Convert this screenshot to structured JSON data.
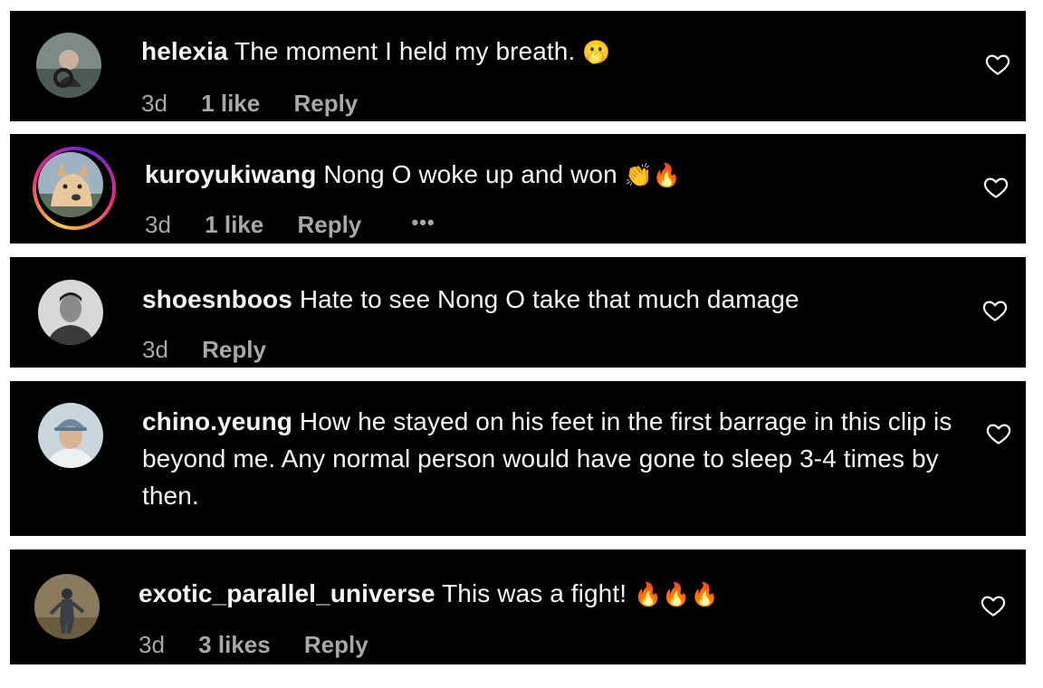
{
  "comments": [
    {
      "username": "helexia",
      "text": "The moment I held my breath.",
      "emoji": "🫢",
      "time": "3d",
      "likes": "1 like",
      "reply": "Reply"
    },
    {
      "username": "kuroyukiwang",
      "text": "Nong O woke up and won",
      "emoji": "👏🔥",
      "time": "3d",
      "likes": "1 like",
      "reply": "Reply",
      "more": "•••"
    },
    {
      "username": "shoesnboos",
      "text": "Hate to see Nong O take that much damage",
      "emoji": "",
      "time": "3d",
      "likes": "",
      "reply": "Reply"
    },
    {
      "username": "chino.yeung",
      "text": "How he stayed on his feet in the first barrage in this clip is beyond me. Any normal person would have gone to sleep 3-4 times by then.",
      "emoji": "",
      "time": "",
      "likes": "",
      "reply": ""
    },
    {
      "username": "exotic_parallel_universe",
      "text": "This was a fight!",
      "emoji": "🔥🔥🔥",
      "time": "3d",
      "likes": "3 likes",
      "reply": "Reply"
    }
  ],
  "icons": {
    "like": "heart-outline-icon",
    "more": "more-horizontal-icon"
  },
  "colors": {
    "card_background": "#000000",
    "primary_text": "#f5f5f5",
    "secondary_text": "#a8a8a8",
    "story_ring": [
      "#f9ce34",
      "#ee2a7b",
      "#6228d7"
    ]
  }
}
